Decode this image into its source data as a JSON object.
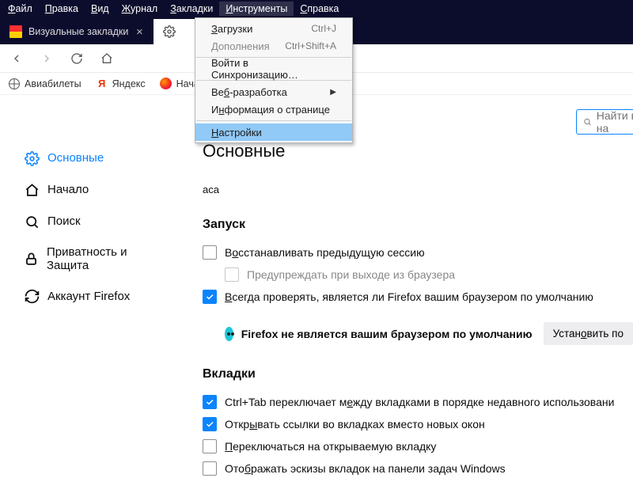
{
  "menubar": {
    "file": {
      "pre": "",
      "u": "Ф",
      "post": "айл"
    },
    "edit": {
      "pre": "",
      "u": "П",
      "post": "равка"
    },
    "view": {
      "pre": "",
      "u": "В",
      "post": "ид"
    },
    "history": {
      "pre": "",
      "u": "Ж",
      "post": "урнал"
    },
    "bookmarks": {
      "pre": "",
      "u": "З",
      "post": "акладки"
    },
    "tools": {
      "pre": "",
      "u": "И",
      "post": "нструменты"
    },
    "help": {
      "pre": "",
      "u": "С",
      "post": "правка"
    }
  },
  "tabs": {
    "t1": "Визуальные закладки",
    "t2": ""
  },
  "dropdown": {
    "downloads": {
      "pre": "",
      "u": "З",
      "post": "агрузки",
      "sc": "Ctrl+J"
    },
    "addons": {
      "pre": "",
      "u": "Д",
      "post": "ополнения",
      "sc": "Ctrl+Shift+A"
    },
    "sync_signin": {
      "label": "Войти в Синхронизацию…"
    },
    "webdev": {
      "pre": "Ве",
      "u": "б",
      "post": "-разработка"
    },
    "pageinfo": {
      "pre": "И",
      "u": "н",
      "post": "формация о странице"
    },
    "settings": {
      "pre": "",
      "u": "Н",
      "post": "астройки"
    }
  },
  "bookmarks_bar": {
    "b1": "Авиабилеты",
    "b2": "Яндекс",
    "b3": "Началь"
  },
  "search_placeholder": "Найти в на",
  "sidebar": {
    "general": "Основные",
    "home": "Начало",
    "search": "Поиск",
    "privacy": "Приватность и Защита",
    "account": "Аккаунт Firefox"
  },
  "main": {
    "heading": "Основные",
    "startup_h": "Запуск",
    "restore": {
      "pre": "В",
      "u": "о",
      "post": "сстанавливать предыдущую сессию"
    },
    "warn": "Предупреждать при выходе из браузера",
    "check": {
      "pre": "",
      "u": "В",
      "post": "сегда проверять, является ли Firefox вашим браузером по умолчанию"
    },
    "not_default": "Firefox не является вашим браузером по умолчанию",
    "set_default": {
      "pre": "Устан",
      "u": "о",
      "post": "вить по"
    },
    "tabs_h": "Вкладки",
    "ctrl_tab": {
      "pre": "Ctrl+Tab переключает м",
      "u": "е",
      "post": "жду вкладками в порядке недавного использовани"
    },
    "open_links": {
      "pre": "Откр",
      "u": "ы",
      "post": "вать ссылки во вкладках вместо новых окон"
    },
    "switch": {
      "pre": "",
      "u": "П",
      "post": "ереключаться на открываемую вкладку"
    },
    "taskbar": {
      "pre": "Ото",
      "u": "б",
      "post": "ражать эскизы вкладок на панели задач Windows"
    }
  }
}
